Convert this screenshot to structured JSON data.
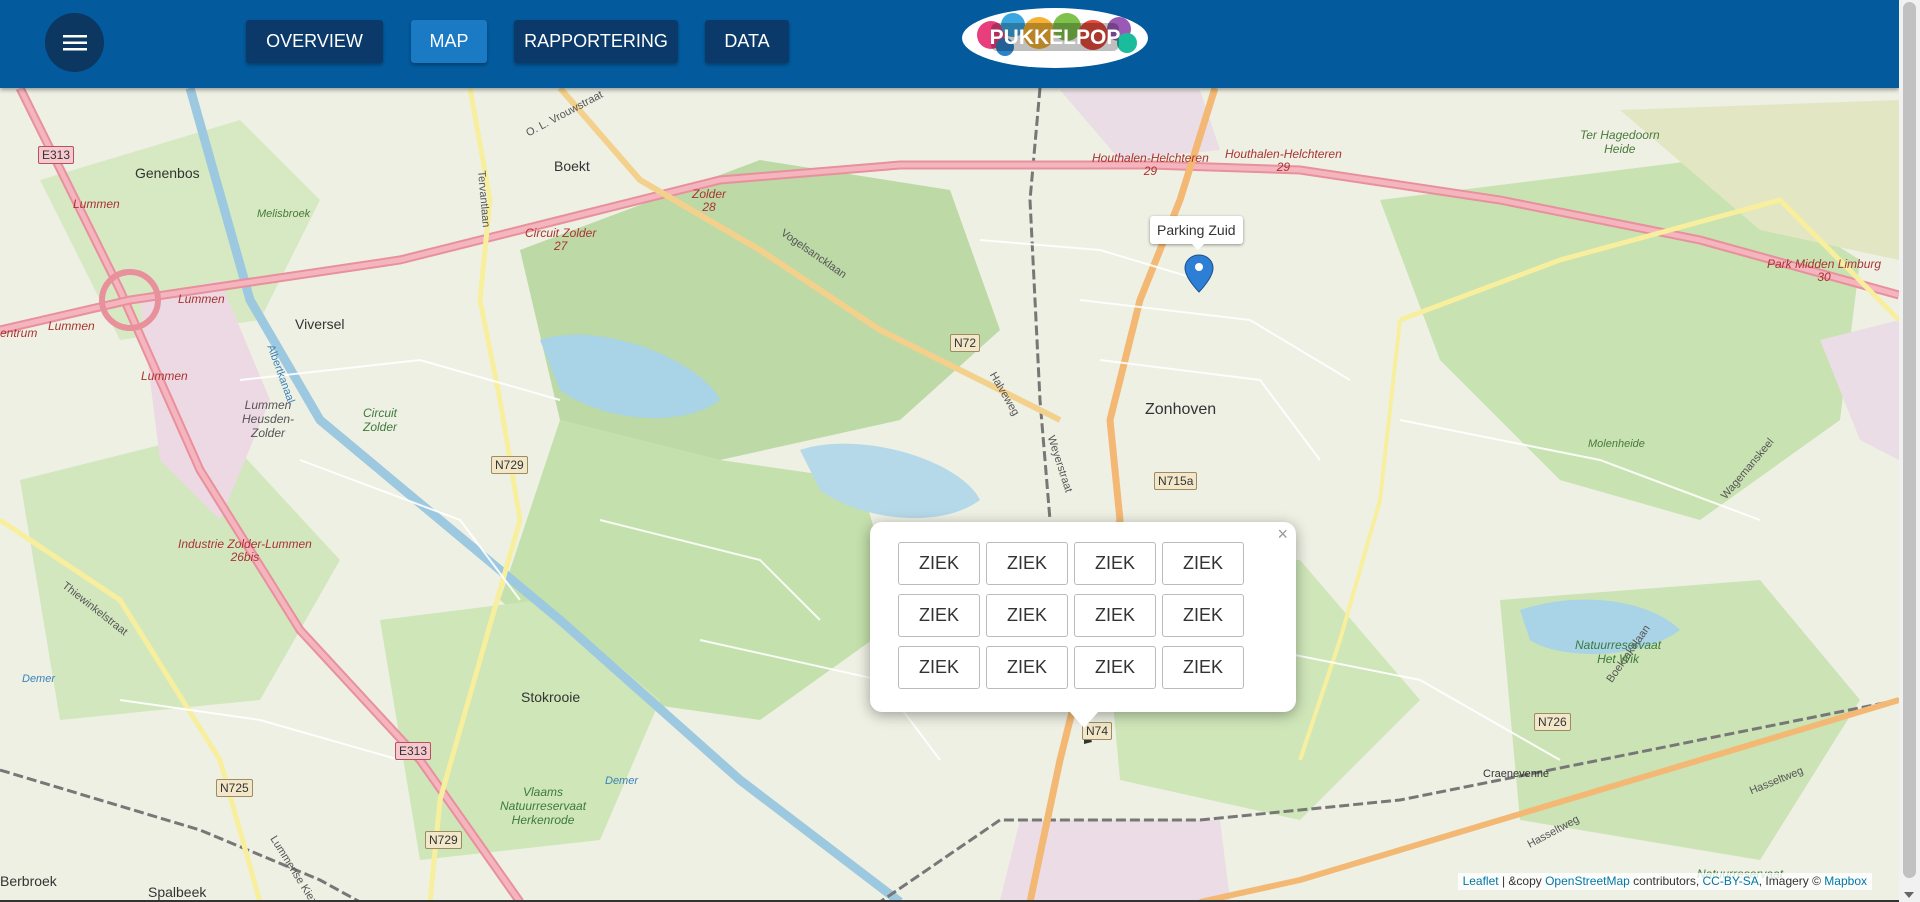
{
  "header": {
    "nav": [
      {
        "label": "OVERVIEW",
        "active": false
      },
      {
        "label": "MAP",
        "active": true
      },
      {
        "label": "RAPPORTERING",
        "active": false
      },
      {
        "label": "DATA",
        "active": false
      }
    ],
    "logo_text": "PUKKELPOP",
    "menu_icon": "hamburger-menu-icon",
    "colors": {
      "bar": "#035a9c",
      "button": "#0b3a6a",
      "active": "#1a7ac4"
    }
  },
  "map": {
    "places": {
      "genenbos": "Genenbos",
      "boekt": "Boekt",
      "viversel": "Viversel",
      "zonhoven": "Zonhoven",
      "stokrooie": "Stokrooie",
      "berbroek": "Berbroek",
      "spalbeek": "Spalbeek",
      "melisbroek": "Melisbroek",
      "molenheide": "Molenheide",
      "ter_hagedoorn": "Ter Hagedoorn\nHeide",
      "lummen_heusden": "Lummen\nHeusden-\nZolder",
      "circuit_zolder_area": "Circuit\nZolder",
      "craenevenne": "Craenevenne",
      "demer_w": "Demer",
      "demer_s": "Demer",
      "entrum": "entrum"
    },
    "roads": {
      "e313_top": "E313",
      "e313_bottom": "E313",
      "n72": "N72",
      "n729_a": "N729",
      "n729_b": "N729",
      "n715a": "N715a",
      "n74": "N74",
      "n726": "N726",
      "n725": "N725"
    },
    "street_names": {
      "vrouwestraat": "O. L. Vrouwstraat",
      "vogelsancklaan": "Vogelsancklaan",
      "halveweg": "Halveweg",
      "weyerstraat": "Weyerstraat",
      "tervantlaan": "Tervantlaan",
      "albertkanaal": "Albertkanaal",
      "thiewinkelstraat": "Thiewinkelstraat",
      "lummense_kiezel": "Lummense Kiezel",
      "wagemanskeel": "Wagemanskeel",
      "boekrakelaan": "Boekrakelaan",
      "hasseltweg": "Hasseltweg",
      "hasseltweg2": "Hasseltweg"
    },
    "junctions": {
      "lummen_1": "Lummen",
      "lummen_2": "Lummen",
      "lummen_3": "Lummen",
      "lummen_4": "Lummen",
      "circuit_zolder": "Circuit Zolder\n27",
      "zolder": "Zolder\n28",
      "houthalen_1": "Houthalen-Helchteren\n29",
      "houthalen_2": "Houthalen-Helchteren\n29",
      "park_midden": "Park Midden Limburg\n30",
      "industrie": "Industrie Zolder-Lummen\n26bis"
    },
    "nature": {
      "het_wik": "Natuurreservaat\nHet Wik",
      "herkenrode": "Vlaams\nNatuurreservaat\nHerkenrode",
      "natuurreservaat_se": "Natuurreservaat"
    },
    "marker_tooltip": "Parking Zuid",
    "popup": {
      "close": "×",
      "buttons": [
        "ZIEK",
        "ZIEK",
        "ZIEK",
        "ZIEK",
        "ZIEK",
        "ZIEK",
        "ZIEK",
        "ZIEK",
        "ZIEK",
        "ZIEK",
        "ZIEK",
        "ZIEK"
      ]
    },
    "attribution": {
      "leaflet": "Leaflet",
      "sep": " | &copy ",
      "osm": "OpenStreetMap",
      "contrib": " contributors, ",
      "license": "CC-BY-SA",
      "imagery": ", Imagery © ",
      "mapbox": "Mapbox"
    }
  }
}
